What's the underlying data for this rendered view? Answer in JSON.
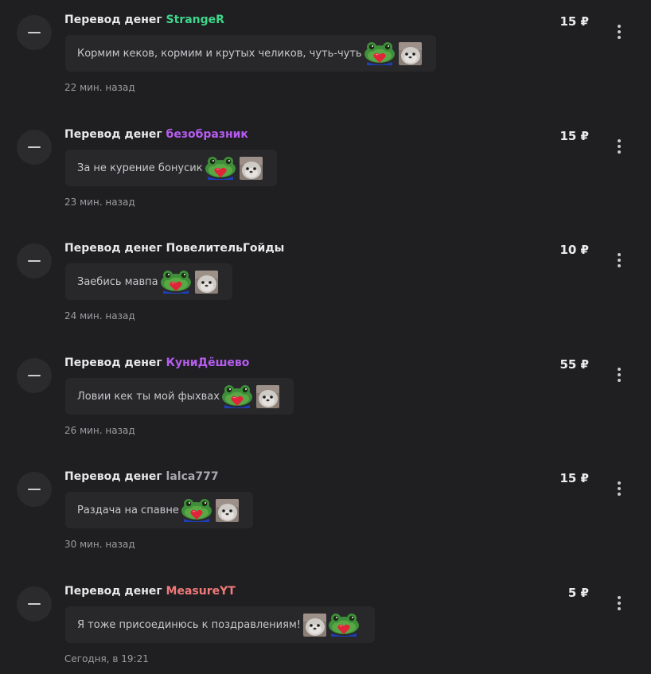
{
  "colors": {
    "background": "#1f1f21",
    "bubble": "#28282b",
    "user_green": "#3ed68a",
    "user_purple": "#b65cf0",
    "user_white": "#eaeaea",
    "user_gray": "#a9a9ad",
    "user_salmon": "#f07a7a"
  },
  "icons": {
    "avatar": "minus-icon",
    "menu": "more-vertical-icon",
    "emote_a": "frog-heart-emote",
    "emote_b": "seal-emote"
  },
  "donations": [
    {
      "prefix": "Перевод денег",
      "user": "StrangeR",
      "user_color": "#3ed68a",
      "amount": "15 ₽",
      "message": "Кормим кеков, кормим и крутых челиков, чуть-чуть",
      "emotes": [
        "frog-heart-emote",
        "seal-emote"
      ],
      "time": "22 мин. назад"
    },
    {
      "prefix": "Перевод денег",
      "user": "безобразник",
      "user_color": "#b65cf0",
      "amount": "15 ₽",
      "message": "За не курение бонусик",
      "emotes": [
        "frog-heart-emote",
        "seal-emote"
      ],
      "time": "23 мин. назад"
    },
    {
      "prefix": "Перевод денег",
      "user": "ПовелительГойды",
      "user_color": "#eaeaea",
      "amount": "10 ₽",
      "message": "Заебись мавпа",
      "emotes": [
        "frog-heart-emote",
        "seal-emote"
      ],
      "time": "24 мин. назад"
    },
    {
      "prefix": "Перевод денег",
      "user": "КуниДёшево",
      "user_color": "#b65cf0",
      "amount": "55 ₽",
      "message": "Ловии кек ты мой фыхвах",
      "emotes": [
        "frog-heart-emote",
        "seal-emote"
      ],
      "time": "26 мин. назад"
    },
    {
      "prefix": "Перевод денег",
      "user": "lalca777",
      "user_color": "#a9a9ad",
      "amount": "15 ₽",
      "message": "Раздача на спавне",
      "emotes": [
        "frog-heart-emote",
        "seal-emote"
      ],
      "time": "30 мин. назад"
    },
    {
      "prefix": "Перевод денег",
      "user": "MeasureYT",
      "user_color": "#f07a7a",
      "amount": "5 ₽",
      "message": "Я тоже присоединюсь к поздравлениям!",
      "emotes": [
        "seal-emote",
        "frog-heart-emote"
      ],
      "time": "Сегодня, в 19:21"
    }
  ]
}
